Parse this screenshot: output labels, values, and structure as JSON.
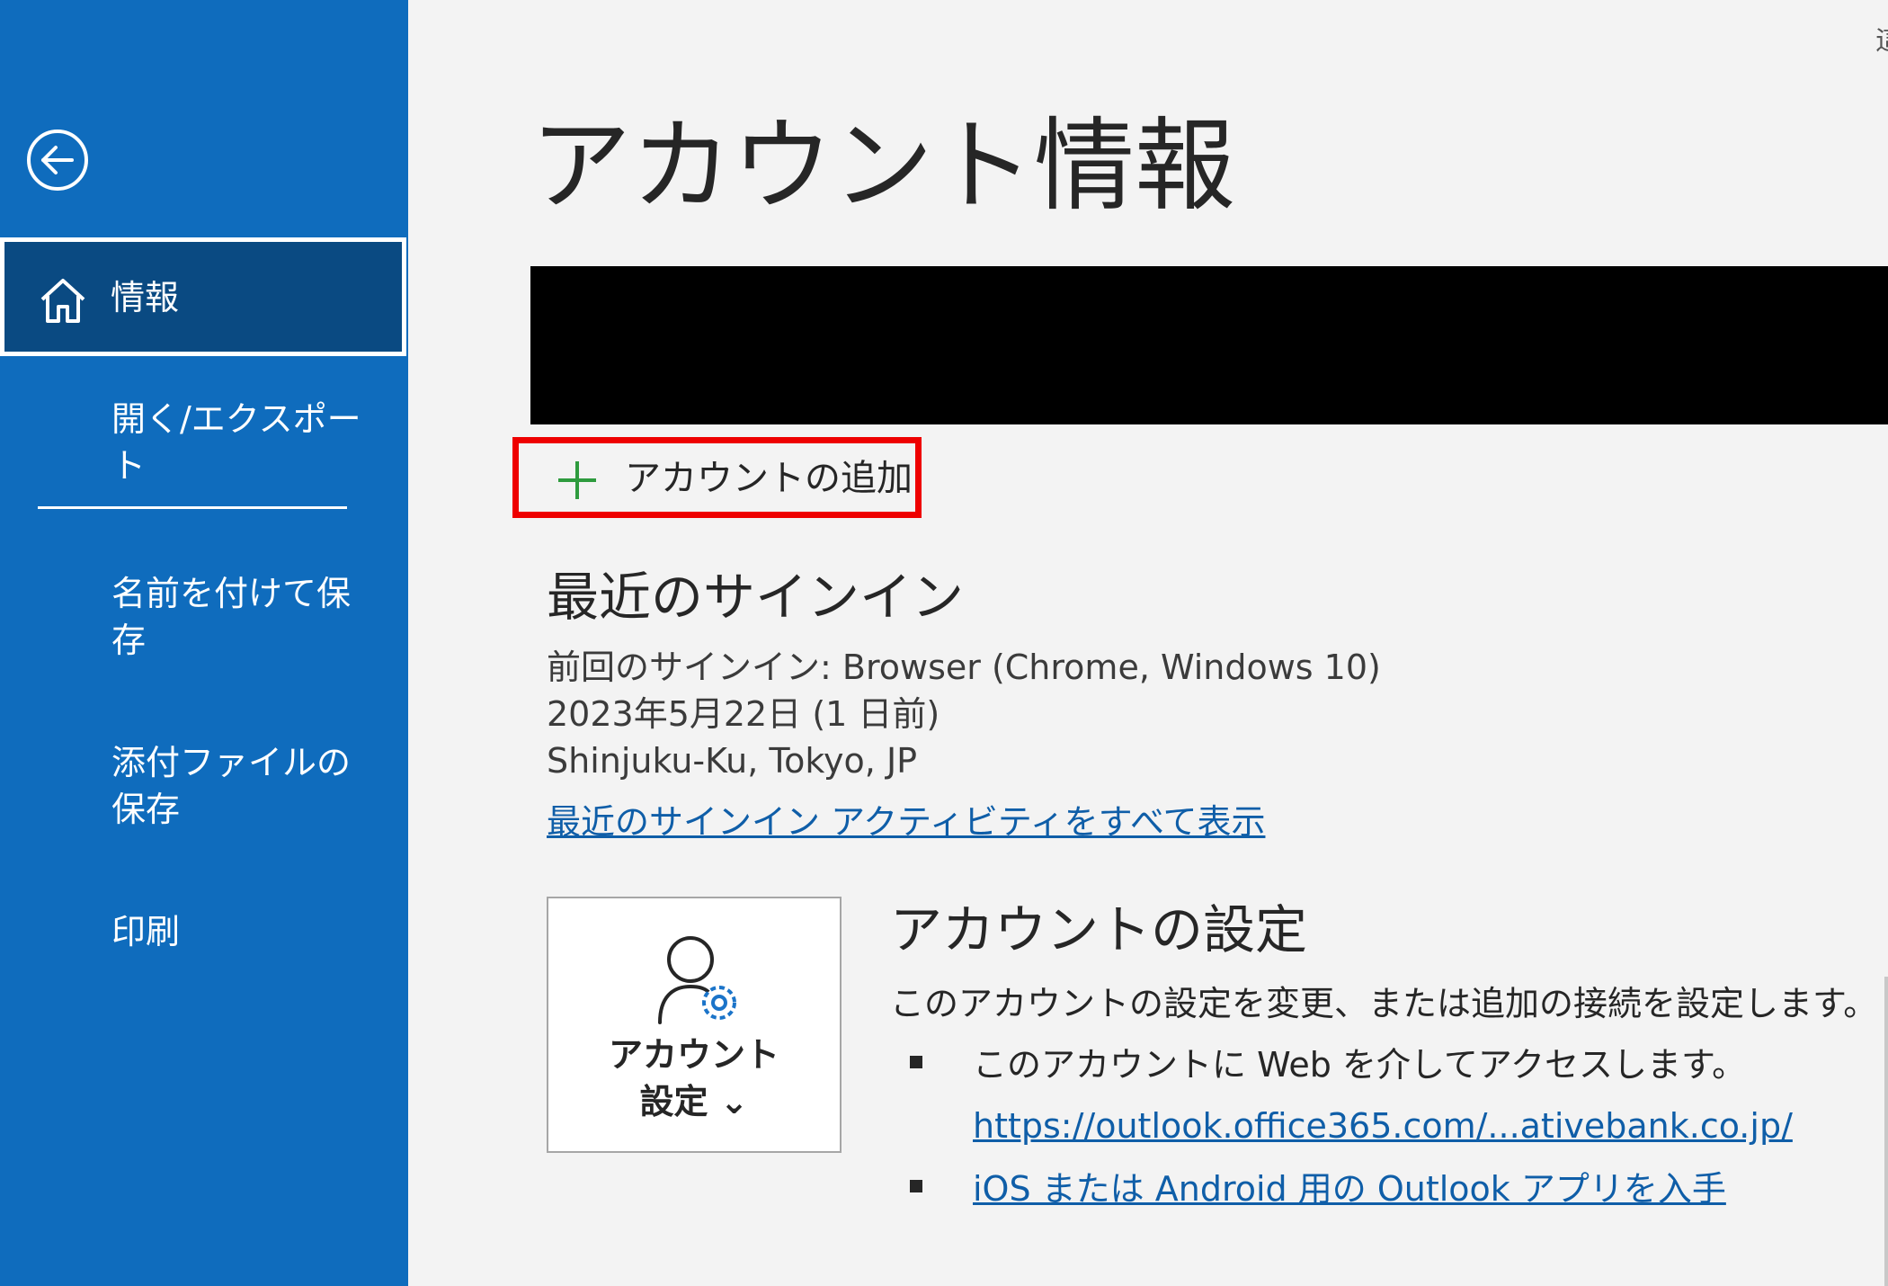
{
  "sidebar": {
    "back_icon": "arrow-left-circle-icon",
    "items": [
      {
        "label": "情報",
        "icon": "home-icon",
        "active": true
      },
      {
        "label": "開く/エクスポート"
      },
      {
        "label": "名前を付けて保存"
      },
      {
        "label": "添付ファイルの保存"
      },
      {
        "label": "印刷"
      }
    ]
  },
  "main": {
    "title": "アカウント情報",
    "add_account": {
      "label": "アカウントの追加",
      "icon": "plus-icon"
    },
    "recent_signin": {
      "title": "最近のサインイン",
      "last_signin": "前回のサインイン: Browser (Chrome, Windows 10)",
      "date": "2023年5月22日 (1 日前)",
      "location": "Shinjuku-Ku, Tokyo, JP",
      "view_all_link": "最近のサインイン アクティビティをすべて表示"
    },
    "account_settings": {
      "button_line1": "アカウント",
      "button_line2": "設定 ⌄",
      "icon": "person-gear-icon",
      "title": "アカウントの設定",
      "description": "このアカウントの設定を変更、または追加の接続を設定します。",
      "bullet1": "このアカウントに Web を介してアクセスします。",
      "web_link": "https://outlook.office365.com/...ativebank.co.jp/",
      "bullet2_link": "iOS または Android 用の Outlook アプリを入手"
    },
    "edge_char": "這"
  },
  "colors": {
    "sidebar": "#0f6cbd",
    "sidebar_active": "#0a4a82",
    "link": "#0f5ea8",
    "highlight_box": "#ee0000",
    "plus": "#2e9b3e"
  }
}
